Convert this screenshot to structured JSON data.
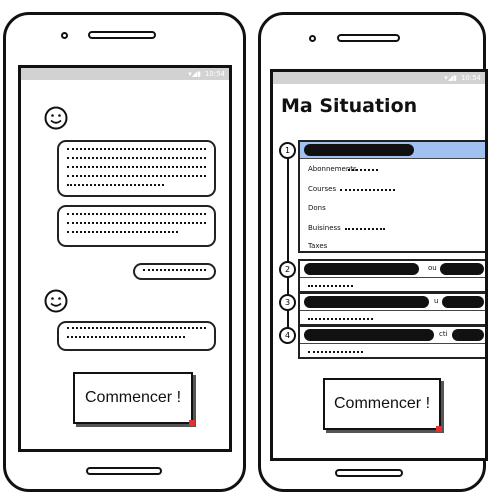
{
  "left_phone": {
    "status_time": "10:54",
    "start_button": "Commencer !"
  },
  "right_phone": {
    "status_time": "10:54",
    "title": "Ma Situation",
    "sections": [
      {
        "number": "1",
        "items": [
          "Abonnements",
          "Courses",
          "Dons",
          "Buisiness",
          "Taxes"
        ]
      },
      {
        "number": "2",
        "peek": "ou"
      },
      {
        "number": "3",
        "peek": "u"
      },
      {
        "number": "4",
        "peek": "cti"
      }
    ],
    "start_button": "Commencer !"
  },
  "icons": [
    "smiley-icon",
    "wifi-icon",
    "signal-icon",
    "battery-icon"
  ]
}
